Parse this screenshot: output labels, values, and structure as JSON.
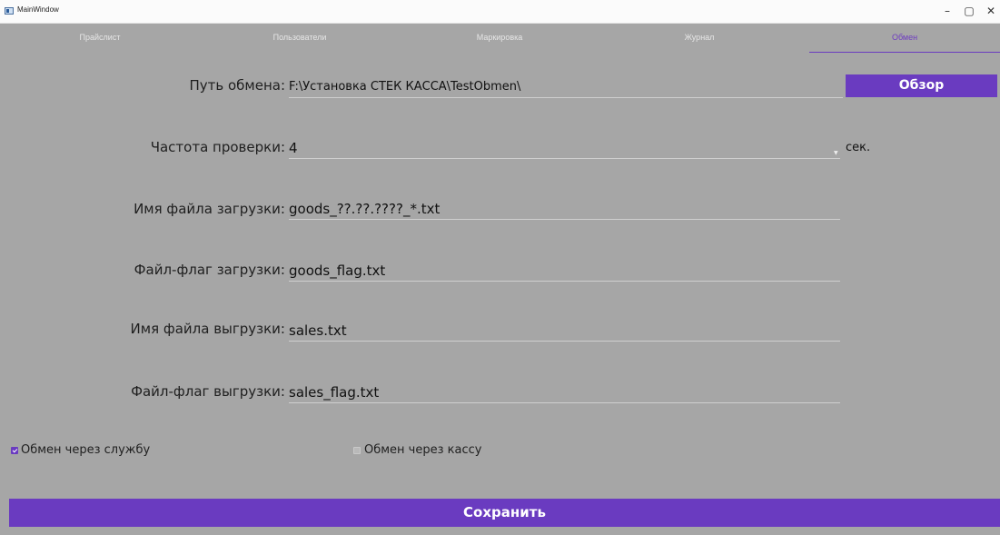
{
  "window": {
    "title": "MainWindow",
    "controls": {
      "minimize": "–",
      "maximize": "▢",
      "close": "✕"
    }
  },
  "tabs": [
    {
      "label": "Прайслист",
      "active": false
    },
    {
      "label": "Пользователи",
      "active": false
    },
    {
      "label": "Маркировка",
      "active": false
    },
    {
      "label": "Журнал",
      "active": false
    },
    {
      "label": "Обмен",
      "active": true
    }
  ],
  "form": {
    "exchange_path": {
      "label": "Путь обмена:",
      "value": "F:\\Установка СТЕК КАССА\\TestObmen\\"
    },
    "browse_button": "Обзор",
    "check_frequency": {
      "label": "Частота проверки:",
      "value": "4",
      "unit": "сек."
    },
    "upload_file_name": {
      "label": "Имя файла загрузки:",
      "value": "goods_??.??.????_*.txt"
    },
    "upload_flag_file": {
      "label": "Файл-флаг загрузки:",
      "value": "goods_flag.txt"
    },
    "download_file_name": {
      "label": "Имя файла выгрузки:",
      "value": "sales.txt"
    },
    "download_flag_file": {
      "label": "Файл-флаг выгрузки:",
      "value": "sales_flag.txt"
    }
  },
  "options": {
    "via_service": {
      "label": "Обмен через службу",
      "checked": true
    },
    "via_register": {
      "label": "Обмен через кассу",
      "checked": false
    }
  },
  "save_button": "Сохранить",
  "colors": {
    "accent": "#6a3bc0",
    "background": "#a6a6a6",
    "titlebar": "#fbfbfb"
  }
}
